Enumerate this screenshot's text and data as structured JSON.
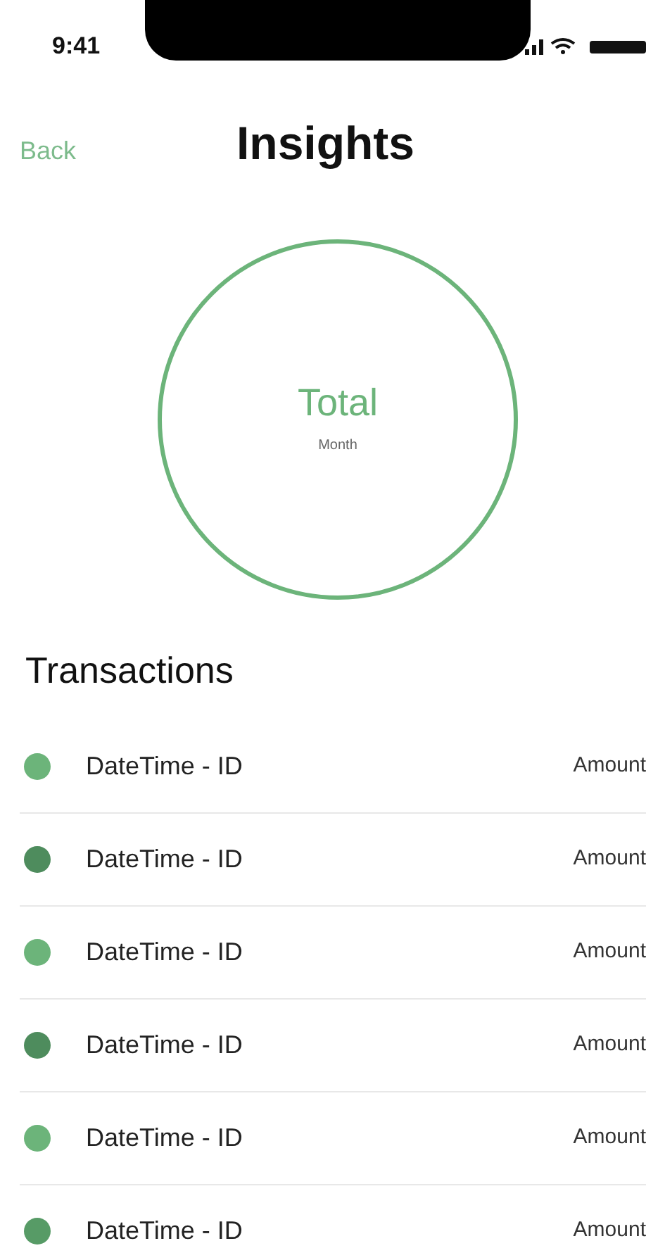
{
  "status_bar": {
    "time": "9:41"
  },
  "nav": {
    "back": "Back",
    "title": "Insights"
  },
  "summary": {
    "label": "Total",
    "period": "Month"
  },
  "section_title": "Transactions",
  "transactions": [
    {
      "label": "DateTime - ID",
      "amount": "Amount",
      "color": "#6cb47a"
    },
    {
      "label": "DateTime - ID",
      "amount": "Amount",
      "color": "#4e8c5d"
    },
    {
      "label": "DateTime - ID",
      "amount": "Amount",
      "color": "#6cb47a"
    },
    {
      "label": "DateTime - ID",
      "amount": "Amount",
      "color": "#4e8c5d"
    },
    {
      "label": "DateTime - ID",
      "amount": "Amount",
      "color": "#6cb47a"
    },
    {
      "label": "DateTime - ID",
      "amount": "Amount",
      "color": "#579b66"
    }
  ]
}
